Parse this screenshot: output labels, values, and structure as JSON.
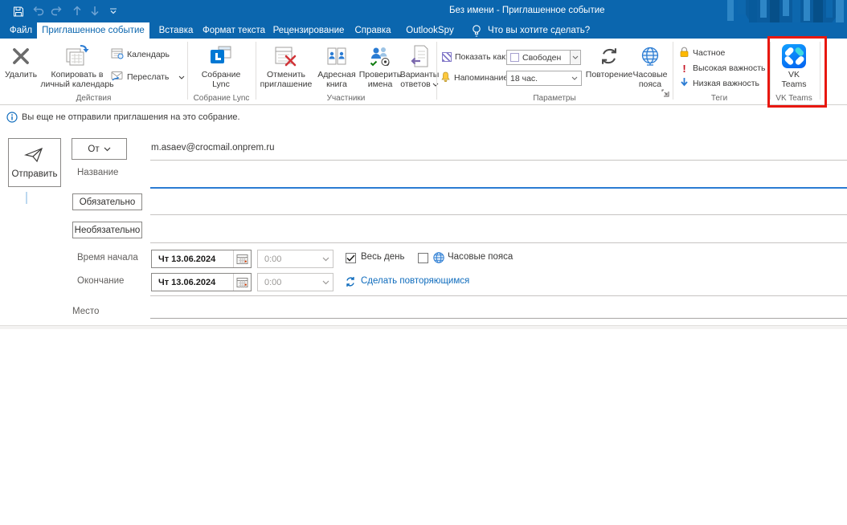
{
  "window": {
    "title": "Без имени - Приглашенное событие"
  },
  "tabs": [
    {
      "label": "Файл"
    },
    {
      "label": "Приглашенное событие"
    },
    {
      "label": "Вставка"
    },
    {
      "label": "Формат текста"
    },
    {
      "label": "Рецензирование"
    },
    {
      "label": "Справка"
    },
    {
      "label": "OutlookSpy"
    }
  ],
  "tell_me": {
    "label": "Что вы хотите сделать?"
  },
  "ribbon": {
    "actions": {
      "group": "Действия",
      "delete": "Удалить",
      "copy_line1": "Копировать в",
      "copy_line2": "личный календарь",
      "calendar": "Календарь",
      "forward": "Переслать"
    },
    "lync": {
      "group": "Собрание Lync",
      "line1": "Собрание",
      "line2": "Lync"
    },
    "attendees": {
      "group": "Участники",
      "cancel_line1": "Отменить",
      "cancel_line2": "приглашение",
      "book_line1": "Адресная",
      "book_line2": "книга",
      "check_line1": "Проверить",
      "check_line2": "имена",
      "resp_line1": "Варианты",
      "resp_line2": "ответов"
    },
    "options": {
      "group": "Параметры",
      "show_as_label": "Показать как:",
      "show_as_value": "Свободен",
      "reminder_label": "Напоминание:",
      "reminder_value": "18 час.",
      "recurrence": "Повторение",
      "tz_line1": "Часовые",
      "tz_line2": "пояса"
    },
    "tags": {
      "group": "Теги",
      "private": "Частное",
      "high": "Высокая важность",
      "high_glyph": "!",
      "low": "Низкая важность"
    },
    "vk": {
      "group": "VK Teams",
      "line1": "VK",
      "line2": "Teams"
    }
  },
  "infobar": {
    "text": "Вы еще не отправили приглашения на это собрание."
  },
  "form": {
    "send_label": "Отправить",
    "from_label": "От",
    "from_value": "m.asaev@crocmail.onprem.ru",
    "title_label": "Название",
    "required_label": "Обязательно",
    "optional_label": "Необязательно",
    "start_label": "Время начала",
    "end_label": "Окончание",
    "start_date": "Чт 13.06.2024",
    "end_date": "Чт 13.06.2024",
    "start_time": "0:00",
    "end_time": "0:00",
    "all_day_label": "Весь день",
    "timezones_label": "Часовые пояса",
    "recurring_label": "Сделать повторяющимся",
    "location_label": "Место"
  },
  "colors": {
    "titlebar_blue": "#0b66ae",
    "accent_blue": "#0f6cbd",
    "focus_underline": "#2b7cd3",
    "highlight_red": "#e8170f",
    "vk_blue": "#0277ff",
    "vk_cyan": "#3fd9e0"
  }
}
